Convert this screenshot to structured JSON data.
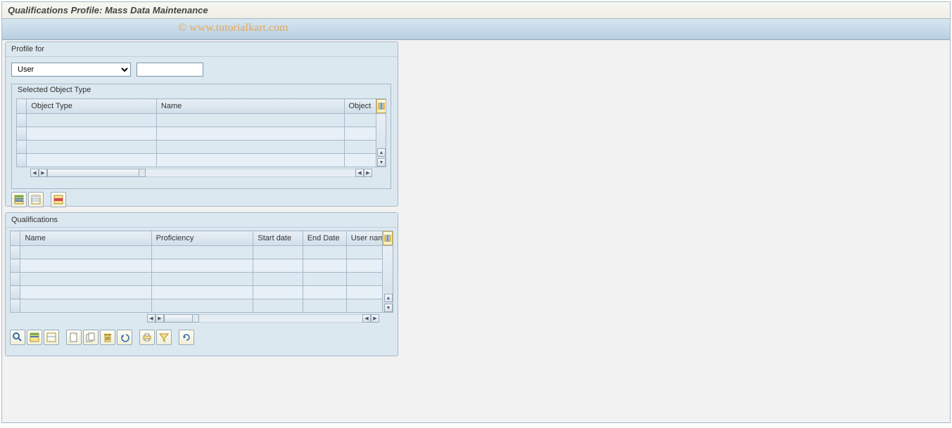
{
  "title": "Qualifications Profile: Mass Data Maintenance",
  "watermark": "© www.tutorialkart.com",
  "profile_panel": {
    "label": "Profile for",
    "select_value": "User",
    "input_value": ""
  },
  "object_type_group": {
    "title": "Selected Object Type",
    "columns": {
      "c1": "Object Type",
      "c2": "Name",
      "c3": "Object"
    }
  },
  "qualifications_panel": {
    "label": "Qualifications",
    "columns": {
      "c1": "Name",
      "c2": "Proficiency",
      "c3": "Start date",
      "c4": "End Date",
      "c5": "User nam"
    }
  },
  "icons": {
    "select_all": "select-all",
    "deselect_all": "deselect-all",
    "delete_row": "delete-row",
    "detail": "detail",
    "new": "new",
    "copy": "copy",
    "delete": "delete",
    "undo": "undo",
    "print": "print",
    "filter": "filter",
    "refresh": "refresh"
  }
}
